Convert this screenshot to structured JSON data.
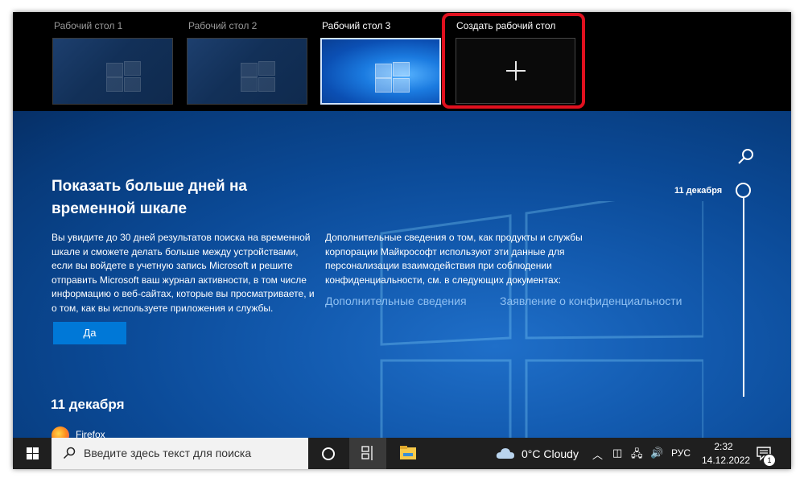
{
  "desktops": [
    {
      "title": "Рабочий стол 1",
      "active": false
    },
    {
      "title": "Рабочий стол 2",
      "active": false
    },
    {
      "title": "Рабочий стол 3",
      "active": true
    }
  ],
  "new_desktop": {
    "title": "Создать рабочий стол",
    "icon": "plus-icon"
  },
  "highlight_color": "#e0101e",
  "timeline": {
    "promo_title": "Показать больше дней на временной шкале",
    "promo_text": "Вы увидите до 30 дней результатов поиска на временной шкале и сможете делать больше между устройствами, если вы войдете в учетную запись Microsoft и решите отправить Microsoft ваш журнал активности, в том числе информацию о веб-сайтах, которые вы просматриваете, и о том, как вы используете приложения и службы.",
    "info_text": "Дополнительные сведения о том, как продукты и службы корпорации Майкрософт используют эти данные для персонализации взаимодействия при соблюдении конфиденциальности, см. в следующих документах:",
    "link_more": "Дополнительные сведения",
    "link_privacy": "Заявление о конфиденциальности",
    "yes_button": "Да",
    "date_heading": "11 декабря",
    "app_label": "Firefox",
    "scrubber_date": "11 декабря",
    "accent": "#0078d7"
  },
  "taskbar": {
    "search_placeholder": "Введите здесь текст для поиска",
    "weather": "0°C  Cloudy",
    "language": "РУС",
    "time": "2:32",
    "date": "14.12.2022",
    "notification_count": "1"
  }
}
